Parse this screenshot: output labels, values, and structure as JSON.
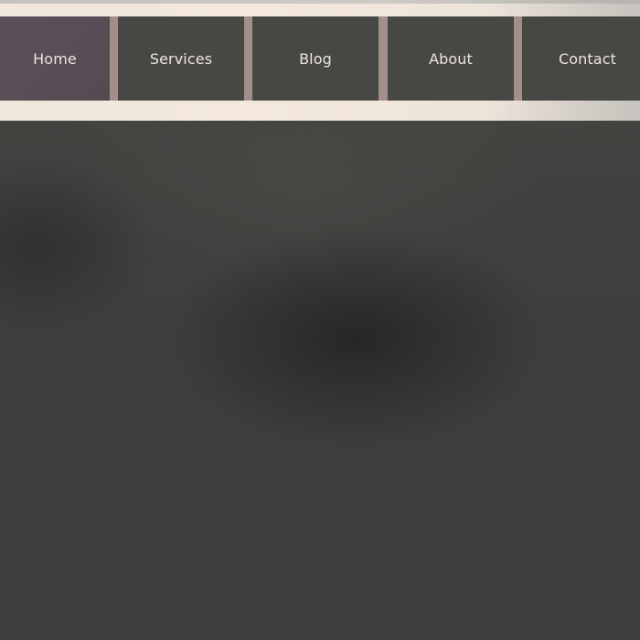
{
  "nav": {
    "items": [
      {
        "label": "Home",
        "active": true
      },
      {
        "label": "Services",
        "active": false
      },
      {
        "label": "Blog",
        "active": false
      },
      {
        "label": "About",
        "active": false
      },
      {
        "label": "Contact",
        "active": false
      }
    ]
  },
  "colors": {
    "header_band": "#f2e7db",
    "nav_separator": "#a38f89",
    "nav_item_bg": "#474744",
    "nav_item_active_bg": "#574d55",
    "nav_text": "#ece5dd",
    "page_bg": "#3e3f3d"
  }
}
